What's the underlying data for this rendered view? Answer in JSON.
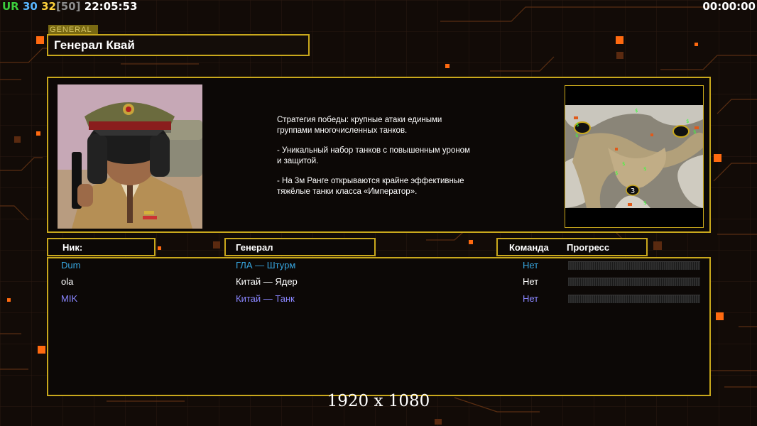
{
  "hud": {
    "ur_label": "UR",
    "val_a": "30",
    "val_b": "32",
    "val_c": "[50]",
    "clock": "22:05:53",
    "timer": "00:00:00"
  },
  "general": {
    "tag": "GENERAL",
    "name": "Генерал Квай"
  },
  "description": [
    "Стратегия победы: крупные атаки едиными\n группами многочисленных танков.",
    "- Уникальный набор танков с повышенным уроном\n и защитой.",
    "- На 3м Ранге открываются крайне эффективные\n тяжёлые танки класса «Император»."
  ],
  "minimap": {
    "player_marker": "3"
  },
  "table": {
    "headers": {
      "nick": "Ник:",
      "general": "Генерал",
      "team": "Команда",
      "progress": "Прогресс"
    },
    "rows": [
      {
        "nick": "Dum",
        "general": "ГЛА — Штурм",
        "team": "Нет",
        "color": "#37a6e0"
      },
      {
        "nick": "ola",
        "general": "Китай — Ядер",
        "team": "Нет",
        "color": "#ffffff"
      },
      {
        "nick": "MIK",
        "general": "Китай — Танк",
        "team": "Нет",
        "color": "#8a86ff"
      }
    ]
  },
  "resolution": "1920 x 1080",
  "colors": {
    "accent": "#c9a81c",
    "highlight": "#ff7a1a"
  }
}
